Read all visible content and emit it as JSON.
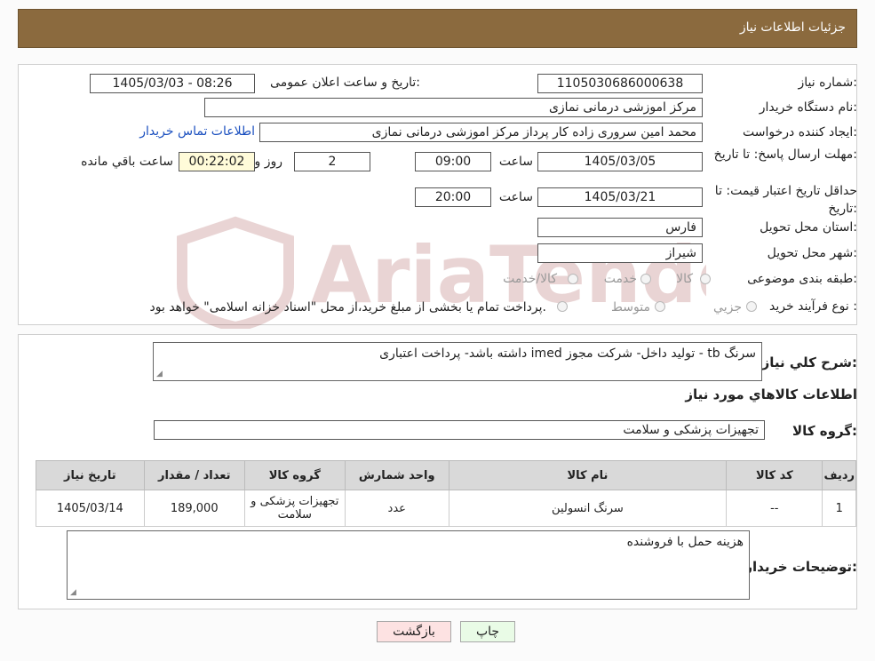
{
  "header": {
    "title": "جزئیات اطلاعات نیاز"
  },
  "form": {
    "need_number_label": "شماره نیاز:",
    "need_number": "1105030686000638",
    "announce_label": "تاریخ و ساعت اعلان عمومی:",
    "announce_value": "1405/03/03 - 08:26",
    "buyer_org_label": "نام دستگاه خریدار:",
    "buyer_org": "مرکز اموزشی درمانی نمازی",
    "creator_label": "ایجاد کننده درخواست:",
    "creator": "محمد امین سروری زاده کار پرداز مرکز اموزشی درمانی نمازی",
    "contact_link": "اطلاعات تماس خریدار",
    "deadline_label": "مهلت ارسال پاسخ: تا تاریخ:",
    "deadline_date": "1405/03/05",
    "time_label": "ساعت",
    "deadline_time": "09:00",
    "days_value": "2",
    "days_label": "روز و",
    "remaining_time": "00:22:02",
    "remaining_label": "ساعت باقي مانده",
    "validity_label": "حداقل تاریخ اعتبار قیمت: تا تاریخ:",
    "validity_date": "1405/03/21",
    "validity_time": "20:00",
    "province_label": "استان محل تحویل:",
    "province": "فارس",
    "city_label": "شهر محل تحویل:",
    "city": "شیراز",
    "category_label": "طبقه بندی موضوعی:",
    "category_options": [
      "کالا",
      "خدمت",
      "کالا/خدمت"
    ],
    "purchase_type_label": "نوع فرآیند خرید :",
    "purchase_options": [
      "جزیي",
      "متوسط"
    ],
    "purchase_note": "پرداخت تمام یا بخشی از مبلغ خرید،از محل \"اسناد خزانه اسلامی\" خواهد بود."
  },
  "details": {
    "summary_label": "شرح کلي نياز:",
    "summary": "سرنگ tb - تولید داخل- شرکت مجوز imed داشته باشد- پرداخت اعتباری",
    "items_title": "اطلاعات کالاهاي مورد نياز",
    "group_label": "گروه کالا:",
    "group_value": "تجهیزات پزشکی و سلامت",
    "table": {
      "headers": [
        "رديف",
        "کد کالا",
        "نام کالا",
        "واحد شمارش",
        "گروه کالا",
        "تعداد / مقدار",
        "تاریخ نیاز"
      ],
      "rows": [
        [
          "1",
          "--",
          "سرنگ انسولین",
          "عدد",
          "تجهیزات پزشکی و سلامت",
          "189,000",
          "1405/03/14"
        ]
      ]
    },
    "buyer_notes_label": "توضیحات خریدار:",
    "buyer_notes": "هزینه حمل با فروشنده"
  },
  "buttons": {
    "print": "چاپ",
    "back": "بازگشت"
  },
  "watermark": {
    "text": "AriaTender.neT"
  }
}
